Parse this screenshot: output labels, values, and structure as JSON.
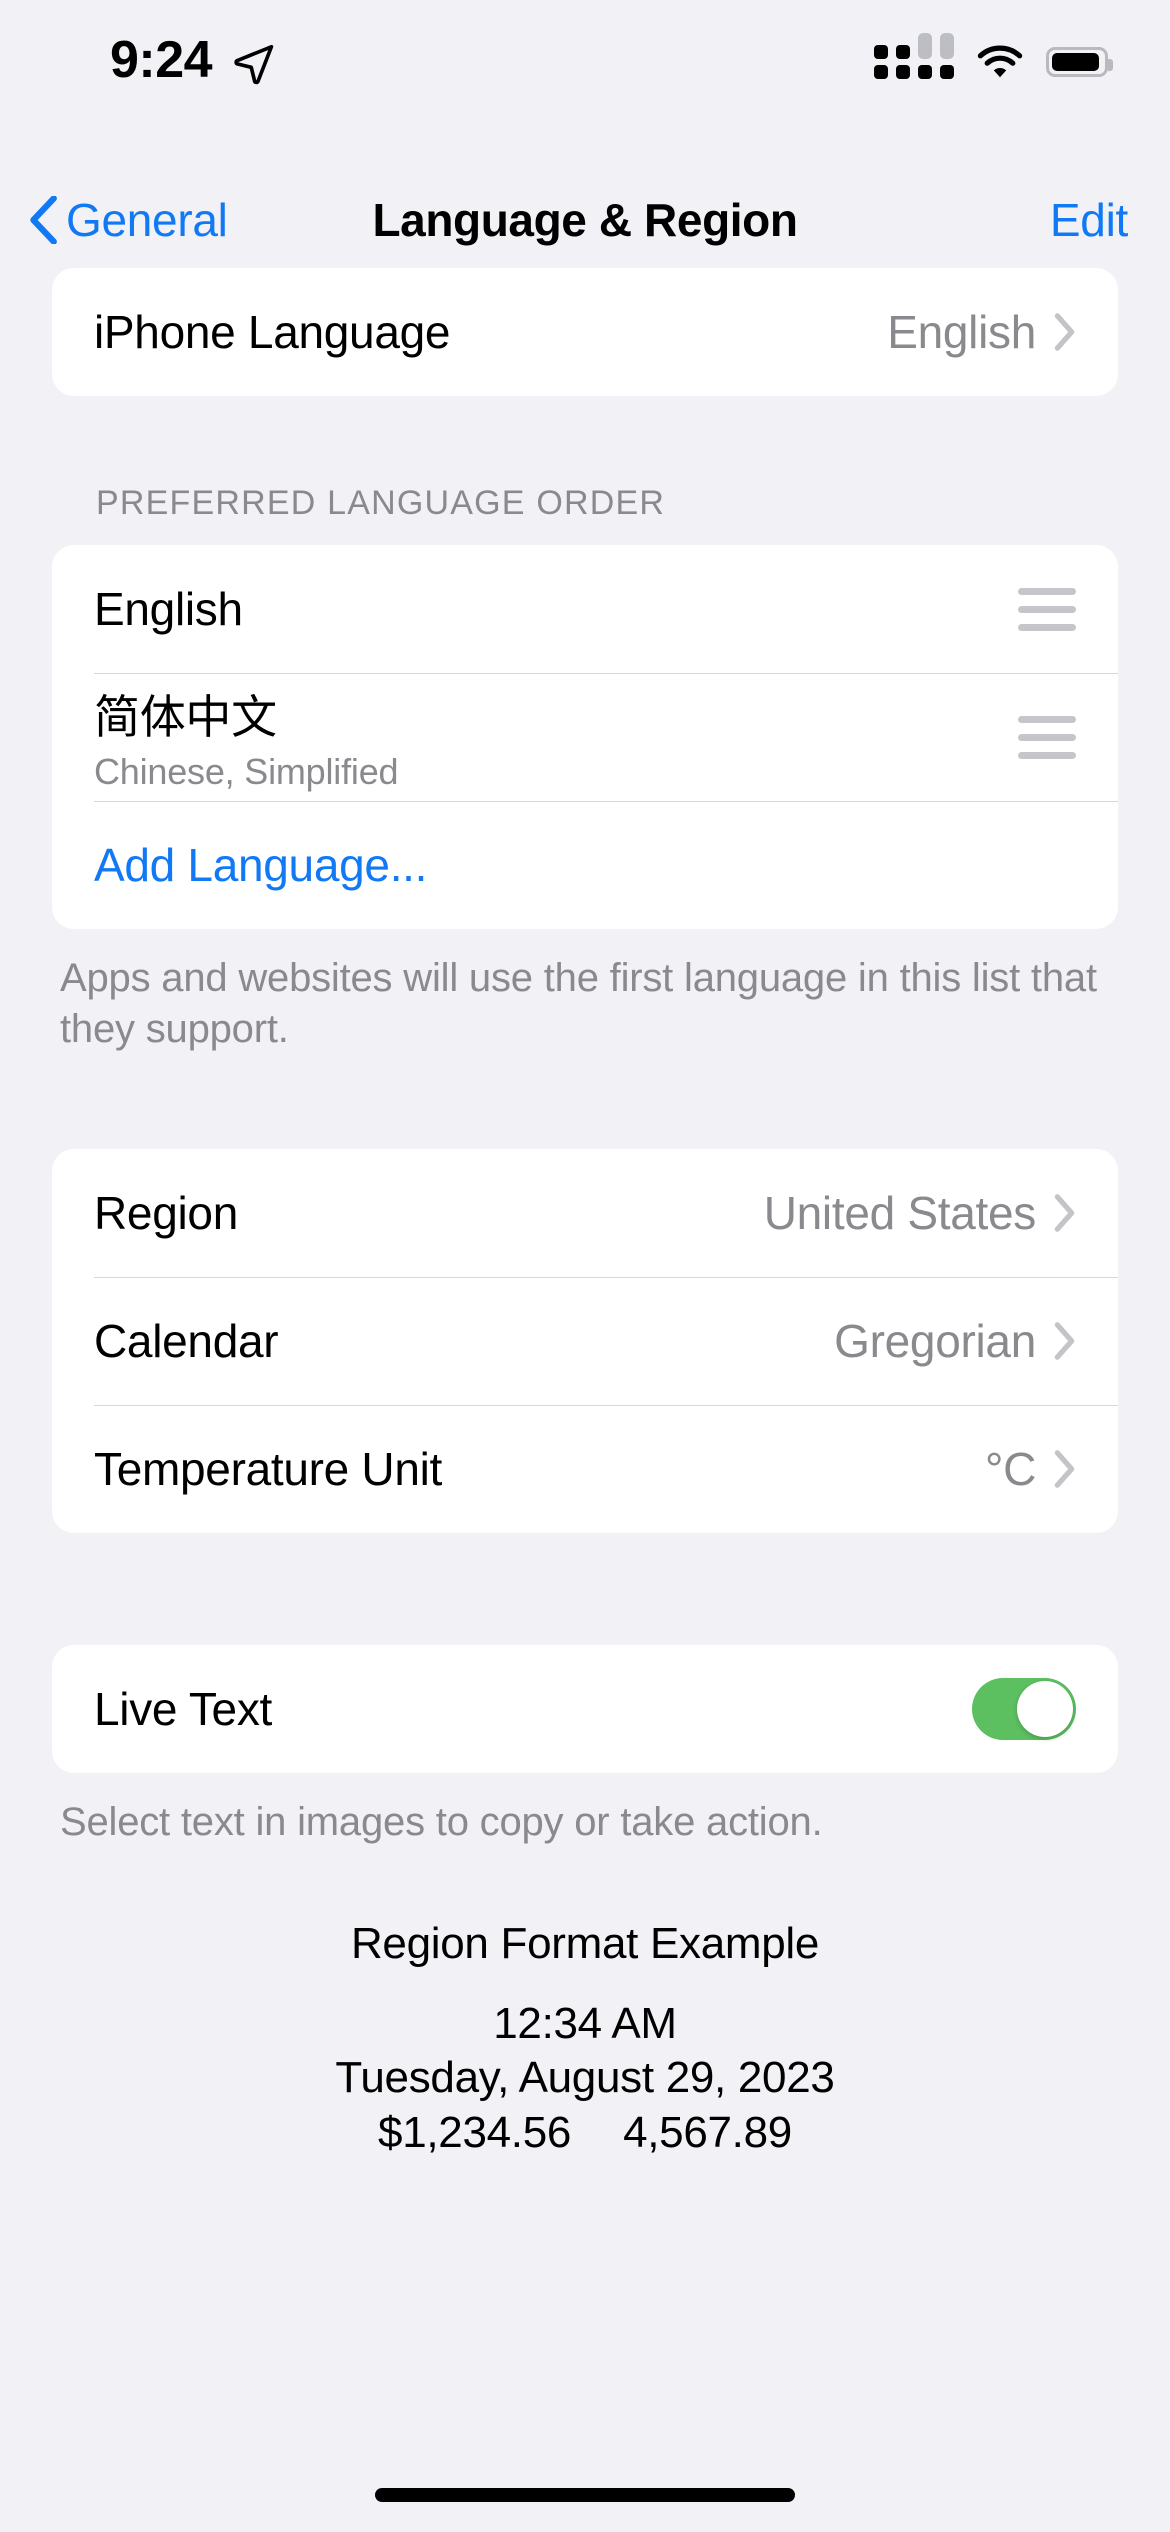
{
  "status_bar": {
    "time": "9:24",
    "location_icon": "location-arrow-icon",
    "cellular_icon": "cellular-signal-icon",
    "wifi_icon": "wifi-icon",
    "battery_icon": "battery-icon"
  },
  "nav": {
    "back_label": "General",
    "back_icon": "chevron-left-icon",
    "title": "Language & Region",
    "edit_label": "Edit"
  },
  "iphone_language": {
    "label": "iPhone Language",
    "value": "English",
    "chevron_icon": "chevron-right-icon"
  },
  "preferred_order": {
    "header": "PREFERRED LANGUAGE ORDER",
    "items": [
      {
        "title": "English",
        "subtitle": "",
        "handle_icon": "drag-handle-icon"
      },
      {
        "title": "简体中文",
        "subtitle": "Chinese, Simplified",
        "handle_icon": "drag-handle-icon"
      }
    ],
    "add_label": "Add Language...",
    "footer": "Apps and websites will use the first language in this list that they support."
  },
  "region_section": {
    "rows": [
      {
        "label": "Region",
        "value": "United States",
        "chevron_icon": "chevron-right-icon"
      },
      {
        "label": "Calendar",
        "value": "Gregorian",
        "chevron_icon": "chevron-right-icon"
      },
      {
        "label": "Temperature Unit",
        "value": "°C",
        "chevron_icon": "chevron-right-icon"
      }
    ]
  },
  "live_text": {
    "label": "Live Text",
    "toggle_state": "on",
    "footer": "Select text in images to copy or take action."
  },
  "region_example": {
    "title": "Region Format Example",
    "time": "12:34 AM",
    "date": "Tuesday, August 29, 2023",
    "currency": "$1,234.56",
    "number": "4,567.89"
  },
  "colors": {
    "background": "#F2F1F6",
    "card": "#FFFFFF",
    "accent_blue": "#1279F5",
    "toggle_green": "#5CBF60",
    "secondary_text": "#8A8A8E",
    "separator": "#D8D8DC"
  }
}
